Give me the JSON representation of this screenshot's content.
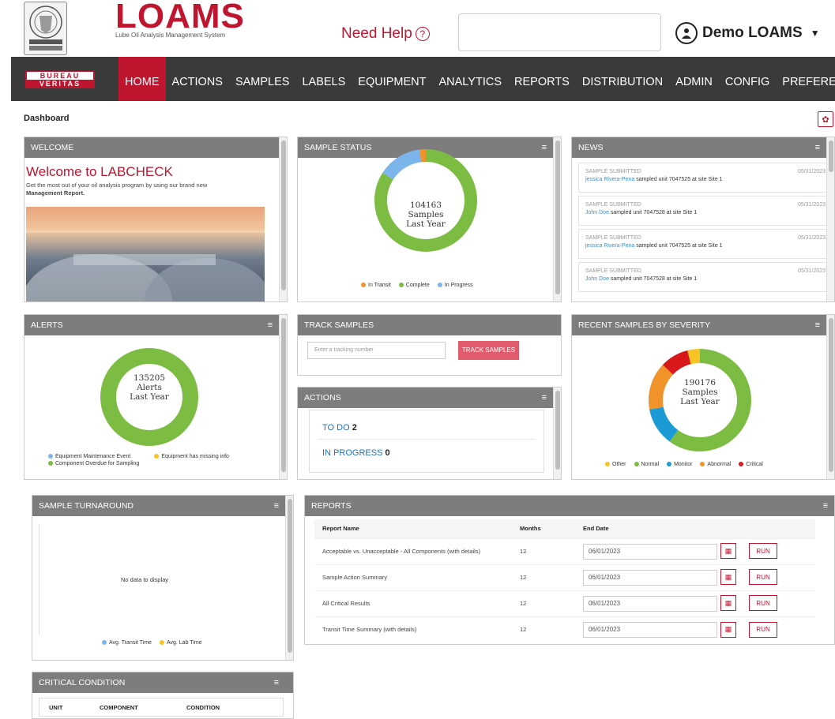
{
  "header": {
    "brand": "LOAMS",
    "brand_sub": "Lube Oil Analysis Management System",
    "help_label": "Need Help",
    "help_icon": "?",
    "user_name": "Demo LOAMS",
    "bv_top": "BUREAU",
    "bv_bottom": "VERITAS"
  },
  "nav": {
    "items": [
      "HOME",
      "ACTIONS",
      "SAMPLES",
      "LABELS",
      "EQUIPMENT",
      "ANALYTICS",
      "REPORTS",
      "DISTRIBUTION",
      "ADMIN",
      "CONFIG",
      "PREFERENCES"
    ],
    "active": "HOME"
  },
  "page": {
    "title": "Dashboard"
  },
  "welcome": {
    "header": "WELCOME",
    "title": "Welcome to LABCHECK",
    "text": "Get the most out of your oil analysis program by using our brand new",
    "bold": "Management Report."
  },
  "sample_status": {
    "header": "SAMPLE STATUS",
    "count": "104163",
    "line1": "Samples",
    "line2": "Last Year",
    "legend": [
      {
        "label": "In Transit",
        "color": "#f0932b"
      },
      {
        "label": "Complete",
        "color": "#7cbc42"
      },
      {
        "label": "In Progress",
        "color": "#7cb5ec"
      }
    ],
    "segments": [
      {
        "label": "Complete",
        "fraction": 0.84,
        "color": "#7cbc42"
      },
      {
        "label": "In Progress",
        "fraction": 0.14,
        "color": "#7cb5ec"
      },
      {
        "label": "In Transit",
        "fraction": 0.02,
        "color": "#f0932b"
      }
    ]
  },
  "news": {
    "header": "NEWS",
    "items": [
      {
        "type": "SAMPLE SUBMITTED",
        "date": "05/31/2023",
        "user": "jessica Rivera-Pena",
        "text": " sampled unit 7047525 at site Site 1"
      },
      {
        "type": "SAMPLE SUBMITTED",
        "date": "05/31/2023",
        "user": "John Doe",
        "text": " sampled unit 7047528 at site Site 1"
      },
      {
        "type": "SAMPLE SUBMITTED",
        "date": "05/31/2023",
        "user": "jessica Rivera-Pena",
        "text": " sampled unit 7047525 at site Site 1"
      },
      {
        "type": "SAMPLE SUBMITTED",
        "date": "05/31/2023",
        "user": "John Doe",
        "text": " sampled unit 7047528 at site Site 1"
      }
    ]
  },
  "alerts": {
    "header": "ALERTS",
    "count": "135205",
    "line1": "Alerts",
    "line2": "Last Year",
    "legend": [
      {
        "label": "Equipment Maintenance Event",
        "color": "#7cb5ec"
      },
      {
        "label": "Equipment has missing info",
        "color": "#f7c325"
      },
      {
        "label": "Component Overdue for Sampling",
        "color": "#7cbc42"
      }
    ]
  },
  "track": {
    "header": "TRACK SAMPLES",
    "placeholder": "Enter a tracking number",
    "button": "TRACK SAMPLES"
  },
  "actions": {
    "header": "ACTIONS",
    "todo_label": "TO DO",
    "todo_count": "2",
    "inprogress_label": "IN PROGRESS",
    "inprogress_count": "0"
  },
  "severity": {
    "header": "RECENT SAMPLES BY SEVERITY",
    "count": "190176",
    "line1": "Samples",
    "line2": "Last Year",
    "legend": [
      {
        "label": "Other",
        "color": "#f7c325"
      },
      {
        "label": "Normal",
        "color": "#7cbc42"
      },
      {
        "label": "Monitor",
        "color": "#1b9ad6"
      },
      {
        "label": "Abnormal",
        "color": "#f0932b"
      },
      {
        "label": "Critical",
        "color": "#d7191c"
      }
    ],
    "segments": [
      {
        "label": "Normal",
        "fraction": 0.6,
        "color": "#7cbc42"
      },
      {
        "label": "Monitor",
        "fraction": 0.12,
        "color": "#1b9ad6"
      },
      {
        "label": "Abnormal",
        "fraction": 0.15,
        "color": "#f0932b"
      },
      {
        "label": "Critical",
        "fraction": 0.09,
        "color": "#d7191c"
      },
      {
        "label": "Other",
        "fraction": 0.04,
        "color": "#f7c325"
      }
    ]
  },
  "turnaround": {
    "header": "SAMPLE TURNAROUND",
    "nodata": "No data to display",
    "legend": [
      {
        "label": "Avg. Transit Time",
        "color": "#7cb5ec"
      },
      {
        "label": "Avg. Lab Time",
        "color": "#f7c325"
      }
    ]
  },
  "reports": {
    "header": "REPORTS",
    "columns": [
      "Report Name",
      "Months",
      "End Date"
    ],
    "run_label": "RUN",
    "rows": [
      {
        "name": "Acceptable vs. Unacceptable - All Components (with details)",
        "months": "12",
        "end_date": "06/01/2023"
      },
      {
        "name": "Sample Action Summary",
        "months": "12",
        "end_date": "06/01/2023"
      },
      {
        "name": "All Critical Results",
        "months": "12",
        "end_date": "06/01/2023"
      },
      {
        "name": "Transit Time Summary (with details)",
        "months": "12",
        "end_date": "06/01/2023"
      }
    ]
  },
  "critical": {
    "header": "CRITICAL CONDITION",
    "columns": [
      "UNIT",
      "COMPONENT",
      "CONDITION"
    ]
  }
}
